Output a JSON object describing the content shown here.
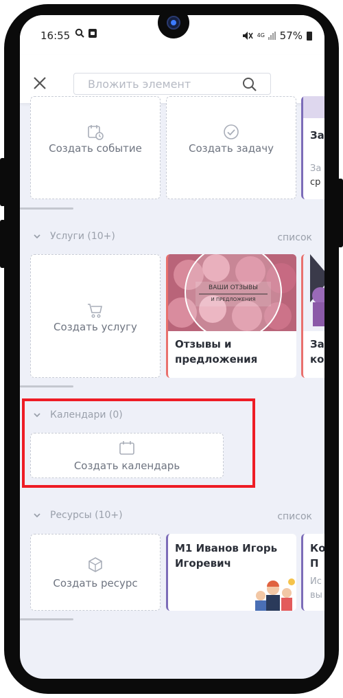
{
  "status_bar": {
    "time": "16:55",
    "network": "4G",
    "battery": "57%"
  },
  "header": {
    "search_placeholder": "Вложить элемент"
  },
  "top_cards": {
    "create_event": "Создать событие",
    "create_task": "Создать задачу",
    "partial_title": "За",
    "partial_sub_1": "За",
    "partial_sub_2": "ср"
  },
  "services": {
    "title": "Услуги (10+)",
    "list_link": "список",
    "create_label": "Создать услугу",
    "image_caption_1": "ВАШИ ОТЗЫВЫ",
    "image_caption_2": "И ПРЕДЛОЖЕНИЯ",
    "card_title": "Отзывы и предложения",
    "partial_title_1": "За",
    "partial_title_2": "ко"
  },
  "calendars": {
    "title": "Календари (0)",
    "create_label": "Создать календарь"
  },
  "resources": {
    "title": "Ресурсы (10+)",
    "list_link": "список",
    "create_label": "Создать ресурс",
    "card_title": "М1 Иванов Игорь Игоревич",
    "partial_title_1": "Ко",
    "partial_title_2": "П",
    "partial_sub_1": "Ис",
    "partial_sub_2": "вы"
  },
  "colors": {
    "highlight": "#ee1c25",
    "accent_purple": "#7c6cb8",
    "accent_red": "#e9706d",
    "background": "#eef0f8"
  }
}
